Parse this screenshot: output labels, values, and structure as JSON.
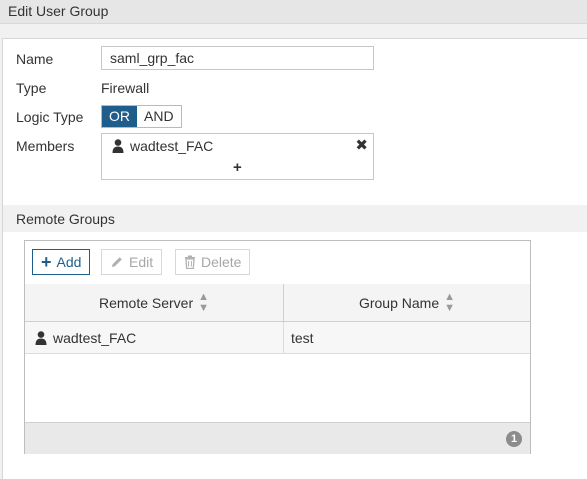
{
  "window": {
    "title": "Edit User Group"
  },
  "form": {
    "name_label": "Name",
    "name_value": "saml_grp_fac",
    "type_label": "Type",
    "type_value": "Firewall",
    "logic_label": "Logic Type",
    "logic_options": [
      "OR",
      "AND"
    ],
    "logic_selected": "OR",
    "members_label": "Members",
    "members": [
      {
        "icon": "user-icon",
        "label": "wadtest_FAC"
      }
    ],
    "remove_glyph": "✖",
    "add_glyph": "+"
  },
  "remote_groups": {
    "section_title": "Remote Groups",
    "toolbar": {
      "add_label": "Add",
      "edit_label": "Edit",
      "delete_label": "Delete"
    },
    "columns": [
      "Remote Server",
      "Group Name"
    ],
    "rows": [
      {
        "server": "wadtest_FAC",
        "server_icon": "user-icon",
        "group": "test"
      }
    ],
    "count": "1"
  },
  "colors": {
    "accent": "#1f5e8b",
    "disabled_text": "#a7a7a7"
  }
}
